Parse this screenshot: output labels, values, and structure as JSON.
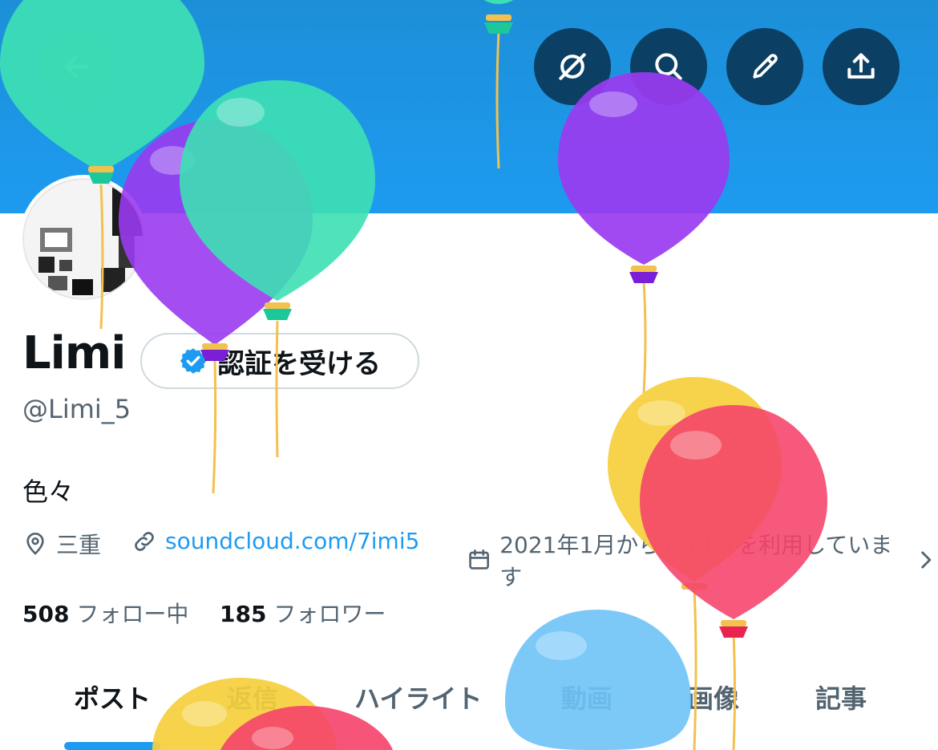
{
  "profile": {
    "name": "Limi",
    "handle": "@Limi_5",
    "bio": "色々",
    "verify_label": "認証を受ける",
    "location": "三重",
    "website": "soundcloud.com/7imi5",
    "joined": "2021年1月からTwitterを利用しています"
  },
  "stats": {
    "following_count": "508",
    "following_label": "フォロー中",
    "followers_count": "185",
    "followers_label": "フォロワー"
  },
  "tabs": [
    {
      "label": "ポスト"
    },
    {
      "label": "返信"
    },
    {
      "label": "ハイライト"
    },
    {
      "label": "動画"
    },
    {
      "label": "画像"
    },
    {
      "label": "記事"
    }
  ],
  "colors": {
    "banner": "#1d9bf0",
    "accent": "#1d9bf0",
    "button_dark": "#0b3f63"
  },
  "icons": [
    "back-arrow-icon",
    "grok-icon",
    "search-icon",
    "edit-icon",
    "share-icon",
    "verified-badge-icon",
    "location-icon",
    "link-icon",
    "calendar-icon",
    "chevron-right-icon"
  ]
}
